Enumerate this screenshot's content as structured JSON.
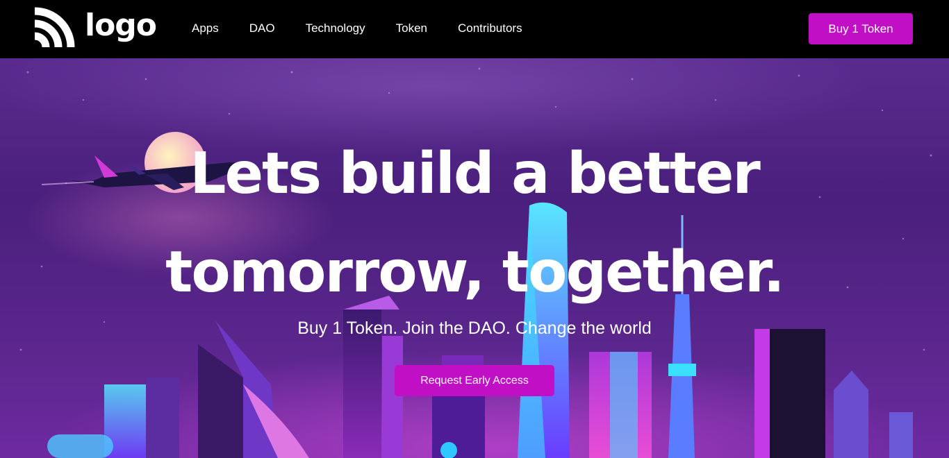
{
  "brand": {
    "logo_text": "logo",
    "logo_icon": "wifi-signal-icon"
  },
  "nav": {
    "items": [
      "Apps",
      "DAO",
      "Technology",
      "Token",
      "Contributors"
    ]
  },
  "header": {
    "buy_label": "Buy 1 Token"
  },
  "hero": {
    "headline_line1": "Lets build a better",
    "headline_line2": "tomorrow, together.",
    "subheadline": "Buy 1 Token. Join the DAO. Change the world",
    "cta_label": "Request Early Access"
  },
  "colors": {
    "accent": "#c00fc5",
    "nav_bg": "#000000",
    "hero_bg": "#4a1f7d"
  }
}
